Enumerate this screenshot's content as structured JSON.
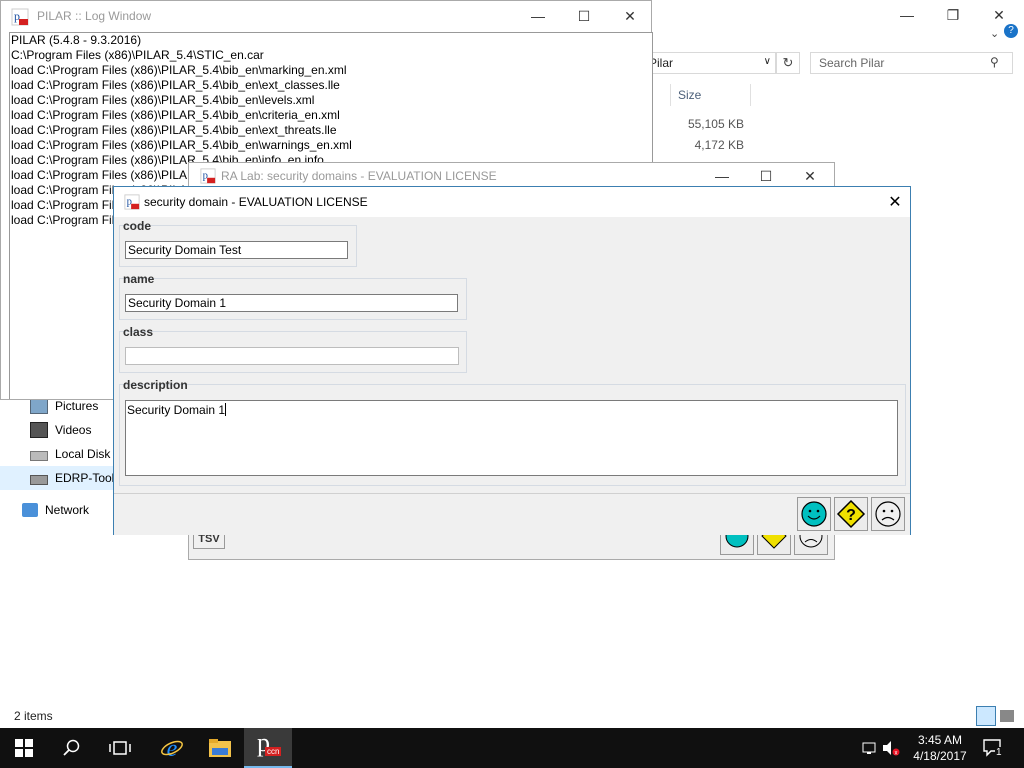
{
  "explorer": {
    "address_text": "Pilar",
    "search_placeholder": "Search Pilar",
    "column_size": "Size",
    "file_sizes": [
      "55,105 KB",
      "4,172 KB"
    ],
    "nav_items": [
      {
        "label": "Pictures",
        "icon": "pictures-folder-icon"
      },
      {
        "label": "Videos",
        "icon": "videos-folder-icon"
      },
      {
        "label": "Local Disk (",
        "icon": "local-disk-icon"
      },
      {
        "label": "EDRP-Tools",
        "icon": "network-drive-icon"
      }
    ],
    "network_label": "Network",
    "status_text": "2 items"
  },
  "log_window": {
    "title": "PILAR :: Log Window",
    "lines": [
      "PILAR (5.4.8 - 9.3.2016)",
      "C:\\Program Files (x86)\\PILAR_5.4\\STIC_en.car",
      "load C:\\Program Files (x86)\\PILAR_5.4\\bib_en\\marking_en.xml",
      "load C:\\Program Files (x86)\\PILAR_5.4\\bib_en\\ext_classes.lle",
      "load C:\\Program Files (x86)\\PILAR_5.4\\bib_en\\levels.xml",
      "load C:\\Program Files (x86)\\PILAR_5.4\\bib_en\\criteria_en.xml",
      "load C:\\Program Files (x86)\\PILAR_5.4\\bib_en\\ext_threats.lle",
      "load C:\\Program Files (x86)\\PILAR_5.4\\bib_en\\warnings_en.xml",
      "load C:\\Program Files (x86)\\PILAR_5.4\\bib_en\\info_en.info",
      "load C:\\Program Files (x86)\\PILAR_5.4\\bib_en\\",
      "load C:\\Program Files (x86)\\PILAR_5.4\\bib_en\\",
      "load C:\\Program Files (x86)\\PILAR_5.4\\bib_en\\",
      "load C:\\Program Files (x86)\\PILAR_5.4\\bib_en\\"
    ]
  },
  "ralab_window": {
    "title": "RA Lab: security domains - EVALUATION LICENSE",
    "tsv_label": "TSV"
  },
  "dialog": {
    "title": "security domain - EVALUATION LICENSE",
    "code_label": "code",
    "code_value": "Security Domain Test",
    "name_label": "name",
    "name_value": "Security Domain 1",
    "class_label": "class",
    "class_value": "",
    "description_label": "description",
    "description_value": "Security Domain 1",
    "buttons": [
      {
        "icon": "happy-face-icon",
        "color": "#00c0c0"
      },
      {
        "icon": "question-diamond-icon",
        "color": "#f0e000"
      },
      {
        "icon": "sad-face-icon",
        "color": "#f0f0f0"
      }
    ]
  },
  "taskbar": {
    "time": "3:45 AM",
    "date": "4/18/2017",
    "notification_count": "1",
    "pilar_badge": "ccn"
  }
}
